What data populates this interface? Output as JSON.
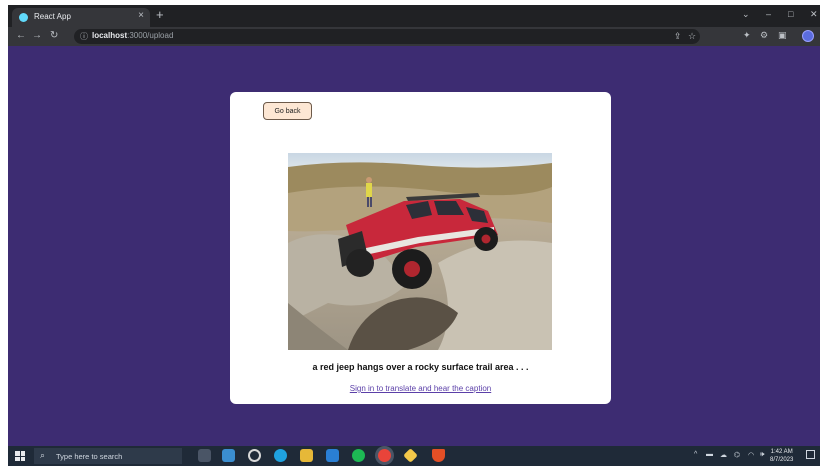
{
  "browser": {
    "tab_title": "React App",
    "tab_close": "×",
    "new_tab": "+",
    "url_host": "localhost",
    "url_path": ":3000/upload",
    "window_controls": {
      "chevron": "⌄",
      "minimize": "–",
      "maximize": "□",
      "close": "✕"
    }
  },
  "page": {
    "back_button": "Go back",
    "caption": "a red jeep hangs over a rocky surface trail area . . .",
    "signin_link": "Sign in to translate and hear the caption"
  },
  "taskbar": {
    "search_placeholder": "Type here to search",
    "time": "1:42 AM",
    "date": "8/7/2023"
  },
  "colors": {
    "page_background": "#3d2c72",
    "card": "#ffffff",
    "back_button_fill": "#fde7d4",
    "link": "#5b3fa8"
  }
}
